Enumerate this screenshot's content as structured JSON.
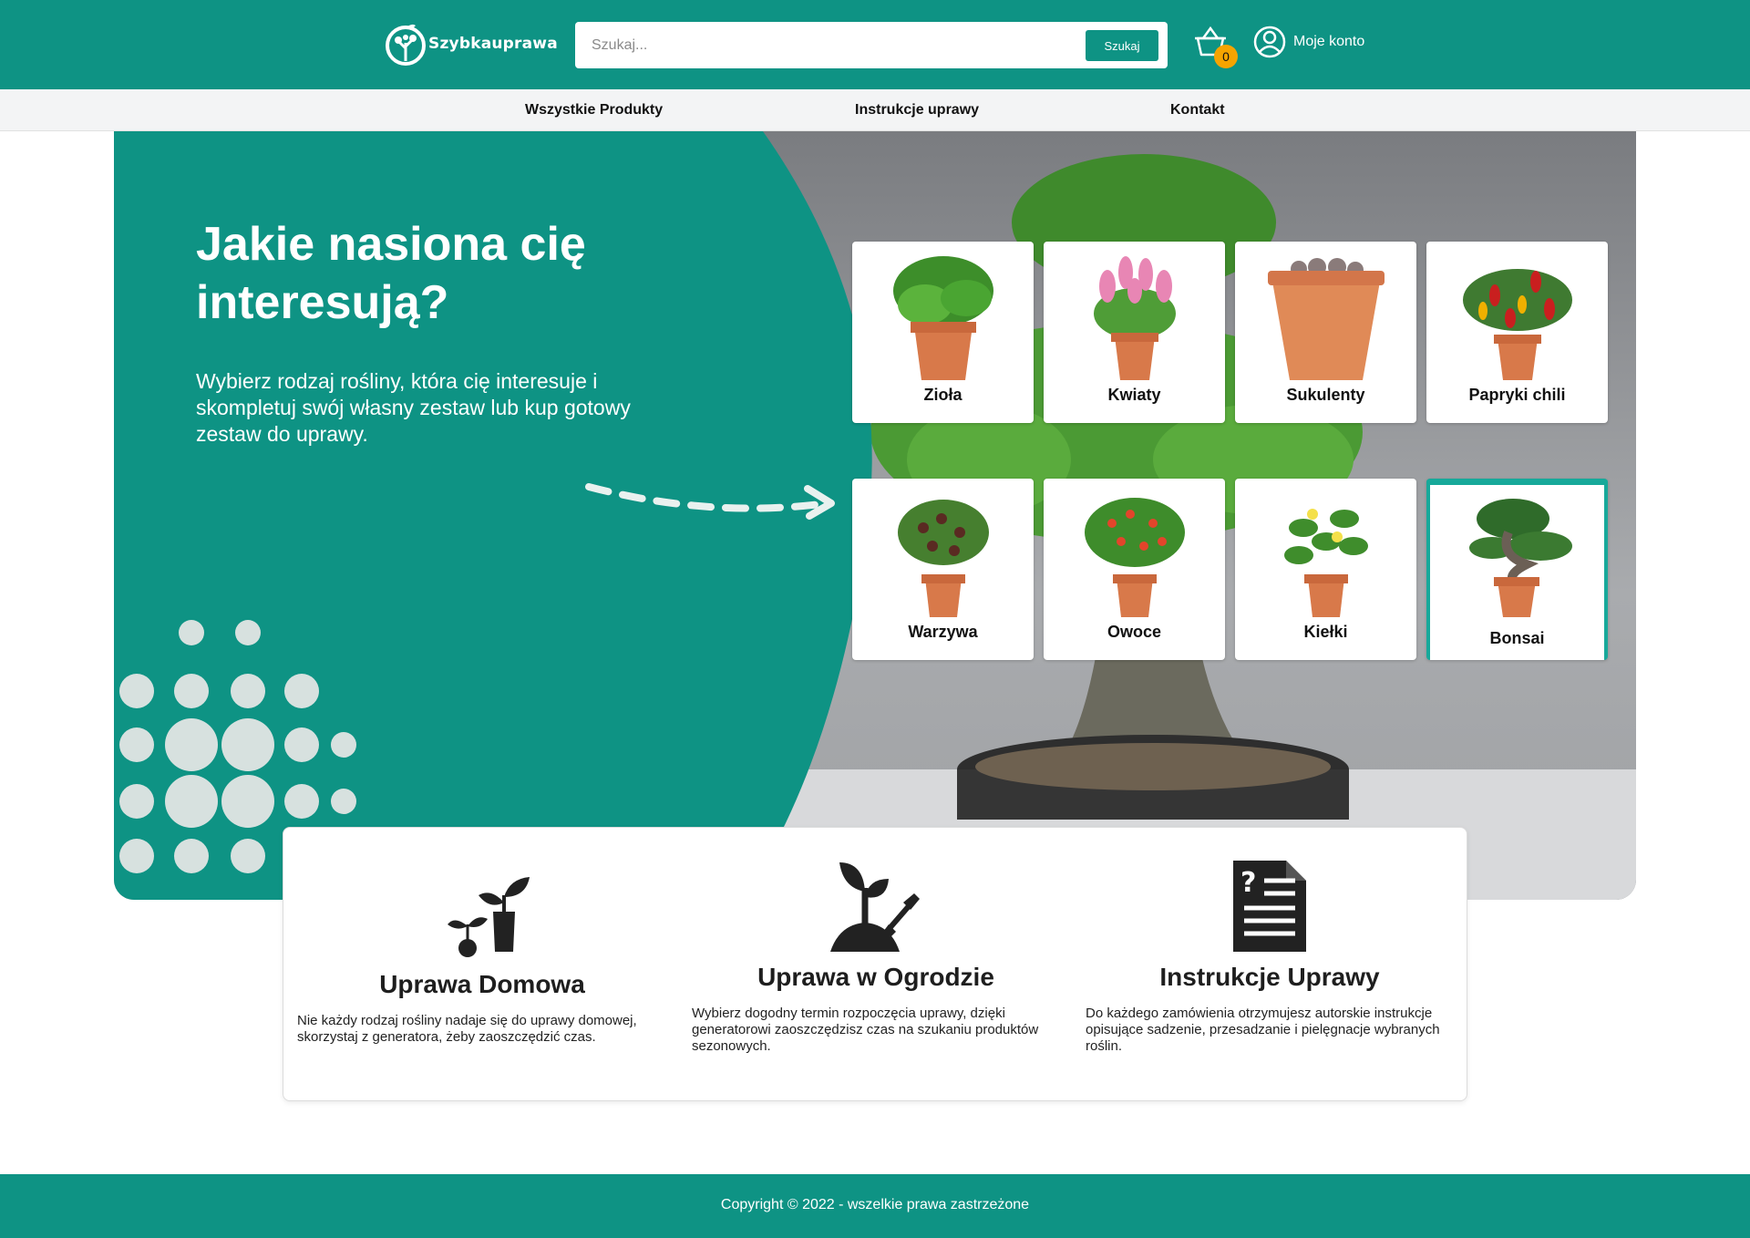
{
  "header": {
    "logo_text": "Szybkauprawa",
    "search_placeholder": "Szukaj...",
    "search_button": "Szukaj",
    "cart_count": "0",
    "account_label": "Moje konto"
  },
  "nav": {
    "items": [
      {
        "label": "Wszystkie Produkty"
      },
      {
        "label": "Instrukcje uprawy"
      },
      {
        "label": "Kontakt"
      }
    ]
  },
  "hero": {
    "title": "Jakie nasiona cię interesują?",
    "description": "Wybierz rodzaj rośliny, która cię interesuje i skompletuj swój własny zestaw lub kup gotowy zestaw do uprawy."
  },
  "categories": [
    {
      "label": "Zioła"
    },
    {
      "label": "Kwiaty"
    },
    {
      "label": "Sukulenty"
    },
    {
      "label": "Papryki chili"
    },
    {
      "label": "Warzywa"
    },
    {
      "label": "Owoce"
    },
    {
      "label": "Kiełki"
    },
    {
      "label": "Bonsai"
    }
  ],
  "features": [
    {
      "title": "Uprawa Domowa",
      "text": "Nie każdy rodzaj rośliny nadaje się do uprawy domowej, skorzystaj z generatora, żeby zaoszczędzić czas."
    },
    {
      "title": "Uprawa w Ogrodzie",
      "text": "Wybierz dogodny termin rozpoczęcia uprawy, dzięki generatorowi zaoszczędzisz czas na szukaniu produktów sezonowych."
    },
    {
      "title": "Instrukcje Uprawy",
      "text": "Do każdego zamówienia otrzymujesz autorskie instrukcje opisujące sadzenie, przesadzanie i pielęgnacje wybranych roślin."
    }
  ],
  "footer": {
    "copyright": "Copyright © 2022 - wszelkie prawa zastrzeżone"
  },
  "colors": {
    "brand": "#0e9384",
    "badge": "#f6a400",
    "accent": "#17a99a"
  }
}
